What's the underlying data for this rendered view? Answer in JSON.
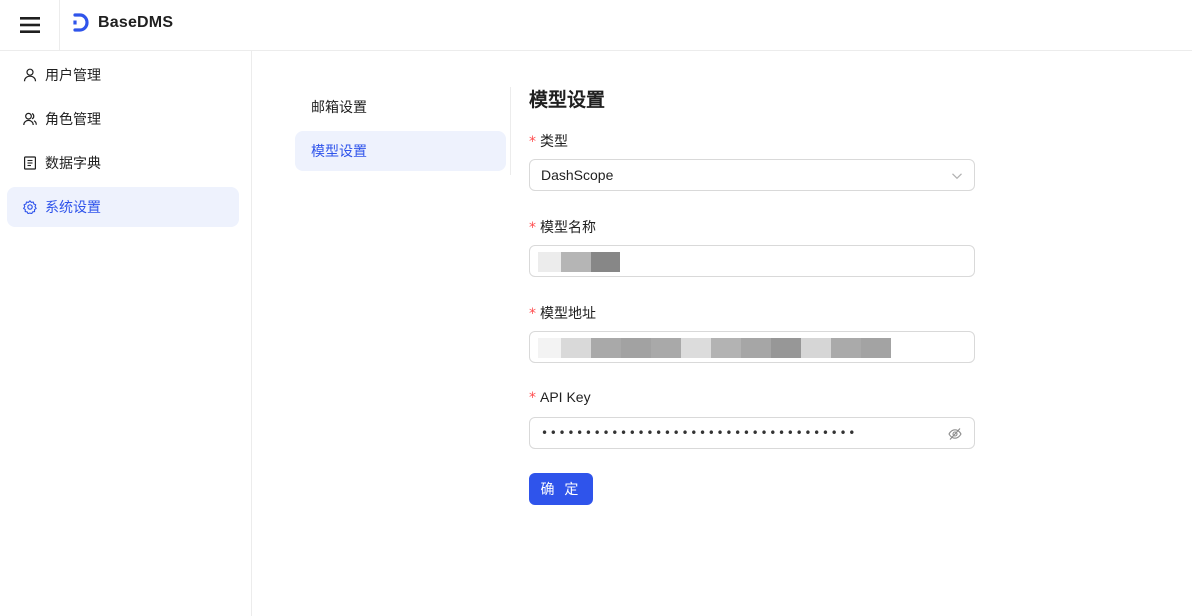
{
  "header": {
    "app_name": "BaseDMS",
    "menu_icon": "hamburger-menu-icon",
    "logo_icon": "basedms-logo-icon",
    "brand_color": "#2f54eb"
  },
  "sidebar": {
    "items": [
      {
        "label": "用户管理",
        "icon": "user-icon",
        "active": false
      },
      {
        "label": "角色管理",
        "icon": "users-icon",
        "active": false
      },
      {
        "label": "数据字典",
        "icon": "book-icon",
        "active": false
      },
      {
        "label": "系统设置",
        "icon": "gear-icon",
        "active": true
      }
    ]
  },
  "settings_nav": {
    "items": [
      {
        "label": "邮箱设置",
        "active": false
      },
      {
        "label": "模型设置",
        "active": true
      }
    ]
  },
  "form": {
    "title": "模型设置",
    "required_mark": "*",
    "type": {
      "label": "类型",
      "value": "DashScope"
    },
    "model_name": {
      "label": "模型名称",
      "value": ""
    },
    "model_url": {
      "label": "模型地址",
      "value": ""
    },
    "api_key": {
      "label": "API Key",
      "value": "••••••••••••••••••••••••••••••••••••"
    },
    "submit_label": "确 定"
  }
}
